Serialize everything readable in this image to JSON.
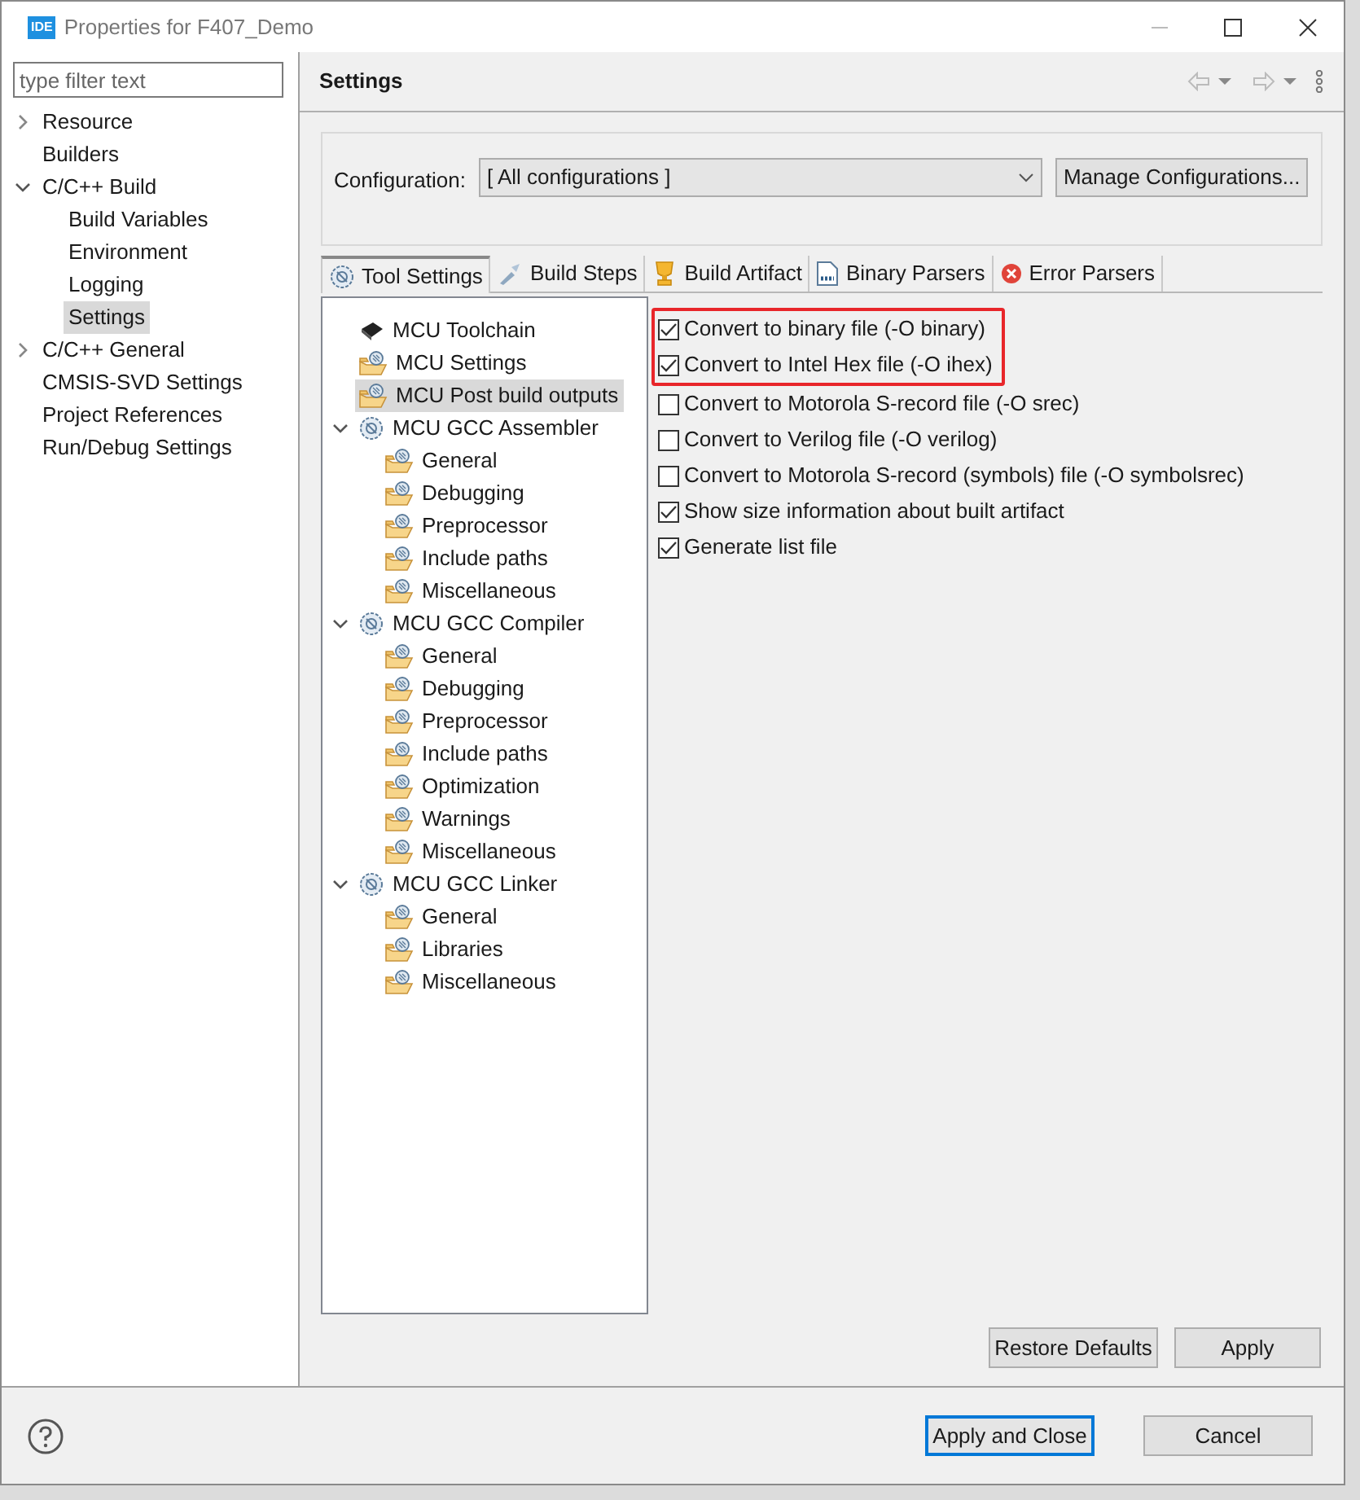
{
  "window": {
    "app_icon": "IDE",
    "title": "Properties for F407_Demo"
  },
  "filter": {
    "placeholder": "type filter text"
  },
  "nav": [
    {
      "label": "Resource",
      "expanded": false,
      "selected": false
    },
    {
      "label": "Builders",
      "selected": false
    },
    {
      "label": "C/C++ Build",
      "expanded": true,
      "selected": false,
      "children": [
        {
          "label": "Build Variables",
          "selected": false
        },
        {
          "label": "Environment",
          "selected": false
        },
        {
          "label": "Logging",
          "selected": false
        },
        {
          "label": "Settings",
          "selected": true
        }
      ]
    },
    {
      "label": "C/C++ General",
      "expanded": false,
      "selected": false
    },
    {
      "label": "CMSIS-SVD Settings",
      "selected": false
    },
    {
      "label": "Project References",
      "selected": false
    },
    {
      "label": "Run/Debug Settings",
      "selected": false
    }
  ],
  "page_title": "Settings",
  "configuration": {
    "label": "Configuration:",
    "value": "[ All configurations ]",
    "manage_button": "Manage Configurations..."
  },
  "tabs": [
    {
      "label": "Tool Settings",
      "kind": "gear",
      "selected": true
    },
    {
      "label": "Build Steps",
      "kind": "brush",
      "selected": false
    },
    {
      "label": "Build Artifact",
      "kind": "trophy",
      "selected": false
    },
    {
      "label": "Binary Parsers",
      "kind": "binary",
      "selected": false
    },
    {
      "label": "Error Parsers",
      "kind": "error",
      "selected": false
    }
  ],
  "tool_tree": [
    {
      "label": "MCU Toolchain",
      "kind": "chip",
      "selected": false
    },
    {
      "label": "MCU Settings",
      "kind": "folder",
      "selected": false
    },
    {
      "label": "MCU Post build outputs",
      "kind": "folder",
      "selected": true
    },
    {
      "label": "MCU GCC Assembler",
      "kind": "gear",
      "selected": false,
      "expanded": true,
      "children": [
        {
          "label": "General",
          "kind": "folder",
          "selected": false
        },
        {
          "label": "Debugging",
          "kind": "folder",
          "selected": false
        },
        {
          "label": "Preprocessor",
          "kind": "folder",
          "selected": false
        },
        {
          "label": "Include paths",
          "kind": "folder",
          "selected": false
        },
        {
          "label": "Miscellaneous",
          "kind": "folder",
          "selected": false
        }
      ]
    },
    {
      "label": "MCU GCC Compiler",
      "kind": "gear",
      "selected": false,
      "expanded": true,
      "children": [
        {
          "label": "General",
          "kind": "folder",
          "selected": false
        },
        {
          "label": "Debugging",
          "kind": "folder",
          "selected": false
        },
        {
          "label": "Preprocessor",
          "kind": "folder",
          "selected": false
        },
        {
          "label": "Include paths",
          "kind": "folder",
          "selected": false
        },
        {
          "label": "Optimization",
          "kind": "folder",
          "selected": false
        },
        {
          "label": "Warnings",
          "kind": "folder",
          "selected": false
        },
        {
          "label": "Miscellaneous",
          "kind": "folder",
          "selected": false
        }
      ]
    },
    {
      "label": "MCU GCC Linker",
      "kind": "gear",
      "selected": false,
      "expanded": true,
      "children": [
        {
          "label": "General",
          "kind": "folder",
          "selected": false
        },
        {
          "label": "Libraries",
          "kind": "folder",
          "selected": false
        },
        {
          "label": "Miscellaneous",
          "kind": "folder",
          "selected": false
        }
      ]
    }
  ],
  "option_groups": [
    {
      "highlighted": true,
      "options": [
        {
          "label": "Convert to binary file (-O binary)",
          "checked": true
        },
        {
          "label": "Convert to Intel Hex file (-O ihex)",
          "checked": true
        }
      ]
    },
    {
      "highlighted": false,
      "options": [
        {
          "label": "Convert to Motorola S-record file (-O srec)",
          "checked": false
        },
        {
          "label": "Convert to Verilog file (-O verilog)",
          "checked": false
        },
        {
          "label": "Convert to Motorola S-record (symbols) file (-O symbolsrec)",
          "checked": false
        },
        {
          "label": "Show size information about built artifact",
          "checked": true
        },
        {
          "label": "Generate list file",
          "checked": true
        }
      ]
    }
  ],
  "page_buttons": [
    {
      "label": "Restore Defaults",
      "selected": false
    },
    {
      "label": "Apply",
      "selected": false
    }
  ],
  "dialog_buttons": [
    {
      "label": "Apply and Close",
      "selected": true
    },
    {
      "label": "Cancel",
      "selected": false
    }
  ]
}
